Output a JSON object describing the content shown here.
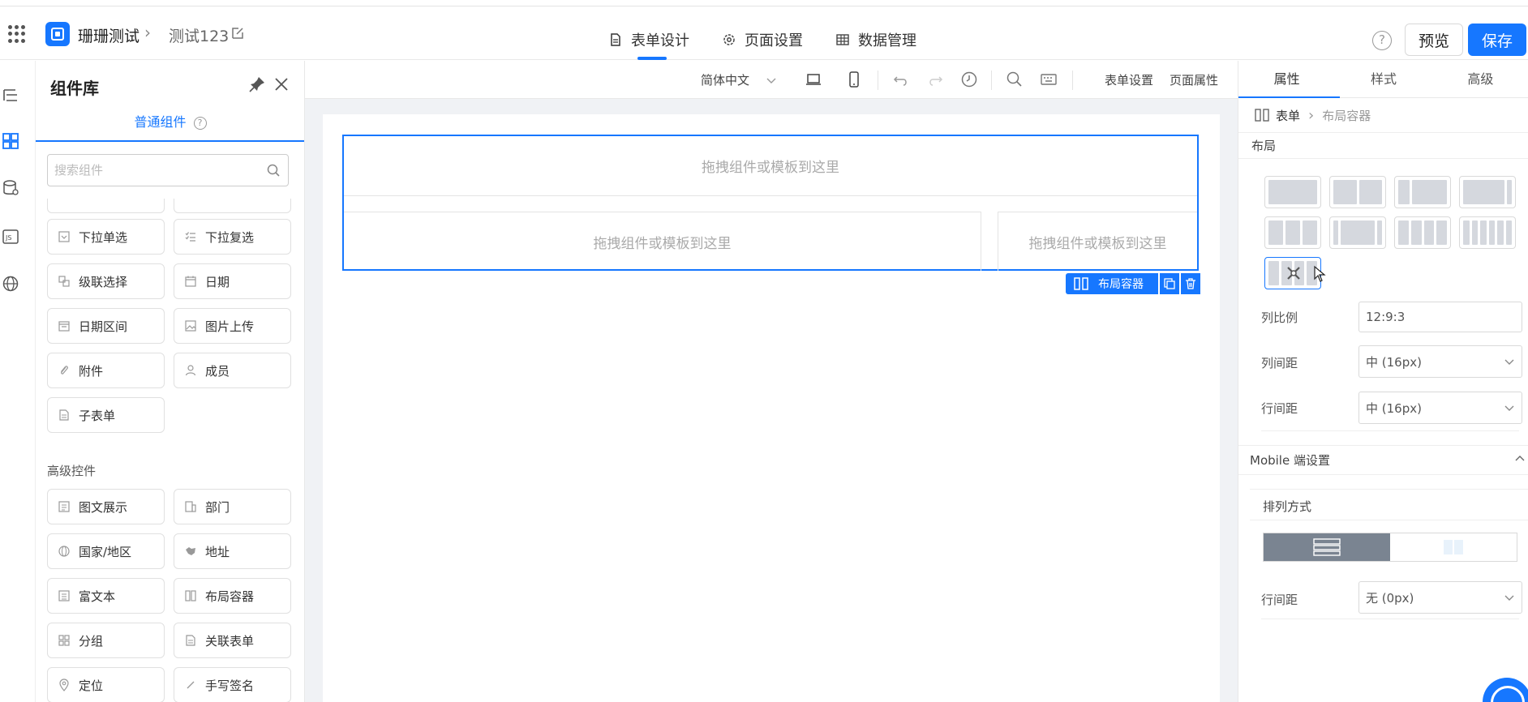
{
  "header": {
    "app_name": "珊珊测试",
    "form_name": "测试123",
    "nav_tabs": [
      {
        "label": "表单设计"
      },
      {
        "label": "页面设置"
      },
      {
        "label": "数据管理"
      }
    ],
    "help_label": "?",
    "preview_label": "预览",
    "save_label": "保存"
  },
  "library": {
    "title": "组件库",
    "tab_label": "普通组件",
    "tab_help": "?",
    "search_placeholder": "搜索组件",
    "components": [
      {
        "label": "下拉单选"
      },
      {
        "label": "下拉复选"
      },
      {
        "label": "级联选择"
      },
      {
        "label": "日期"
      },
      {
        "label": "日期区间"
      },
      {
        "label": "图片上传"
      },
      {
        "label": "附件"
      },
      {
        "label": "成员"
      },
      {
        "label": "子表单"
      }
    ],
    "advanced_title": "高级控件",
    "advanced": [
      {
        "label": "图文展示"
      },
      {
        "label": "部门"
      },
      {
        "label": "国家/地区"
      },
      {
        "label": "地址"
      },
      {
        "label": "富文本"
      },
      {
        "label": "布局容器"
      },
      {
        "label": "分组"
      },
      {
        "label": "关联表单"
      },
      {
        "label": "定位"
      },
      {
        "label": "手写签名"
      }
    ]
  },
  "toolbar": {
    "language": "简体中文",
    "form_settings": "表单设置",
    "page_props": "页面属性"
  },
  "canvas": {
    "drop_hint": "拖拽组件或模板到这里",
    "layout_tag": "布局容器"
  },
  "props": {
    "tabs": [
      {
        "label": "属性"
      },
      {
        "label": "样式"
      },
      {
        "label": "高级"
      }
    ],
    "crumb_form": "表单",
    "crumb_layout": "布局容器",
    "layout_section": "布局",
    "col_ratio_label": "列比例",
    "col_ratio_value": "12:9:3",
    "col_gap_label": "列间距",
    "col_gap_value": "中 (16px)",
    "row_gap_label": "行间距",
    "row_gap_value": "中 (16px)",
    "mobile_section": "Mobile 端设置",
    "arrange_label": "排列方式",
    "mobile_row_gap_label": "行间距",
    "mobile_row_gap_value": "无 (0px)"
  },
  "colors": {
    "accent": "#1677ff",
    "selected_segment": "#7a8491"
  }
}
